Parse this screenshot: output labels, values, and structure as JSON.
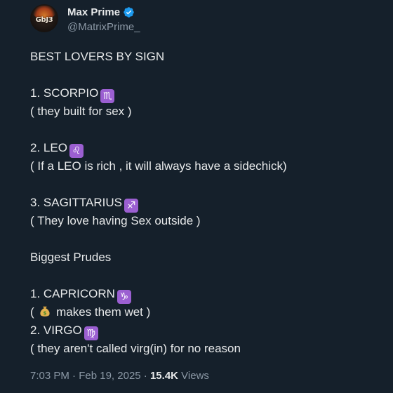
{
  "author": {
    "display_name": "Max Prime",
    "handle": "@MatrixPrime_",
    "avatar_text": "GbJ3",
    "verified": true
  },
  "tweet": {
    "lines": [
      {
        "text": "BEST LOVERS BY SIGN"
      },
      {
        "text": ""
      },
      {
        "text": "1. SCORPIO",
        "icon": "scorpio-icon",
        "glyph": "♏"
      },
      {
        "text": "( they built for sex )"
      },
      {
        "text": ""
      },
      {
        "text": "2. LEO",
        "icon": "leo-icon",
        "glyph": "♌"
      },
      {
        "text": "( If a LEO is rich , it will always have a sidechick)"
      },
      {
        "text": ""
      },
      {
        "text": "3. SAGITTARIUS",
        "icon": "sagittarius-icon",
        "glyph": "♐"
      },
      {
        "text": "( They love having Sex outside )"
      },
      {
        "text": ""
      },
      {
        "text": "Biggest Prudes"
      },
      {
        "text": ""
      },
      {
        "text": "1. CAPRICORN",
        "icon": "capricorn-icon",
        "glyph": "♑"
      },
      {
        "prefix": "(",
        "icon": "money-bag-icon",
        "text": "makes them wet )"
      },
      {
        "text": "2. VIRGO",
        "icon": "virgo-icon",
        "glyph": "♍"
      },
      {
        "text": "( they aren't called virg(in) for no reason"
      }
    ]
  },
  "meta": {
    "time": "7:03 PM",
    "date": "Feb 19, 2025",
    "separator": "·",
    "views_count": "15.4K",
    "views_label": "Views"
  },
  "colors": {
    "background": "#15202b",
    "text": "#e7e9ea",
    "secondary": "#8b98a5",
    "verified": "#1d9bf0",
    "zodiac_badge": "#9b5fd1"
  }
}
